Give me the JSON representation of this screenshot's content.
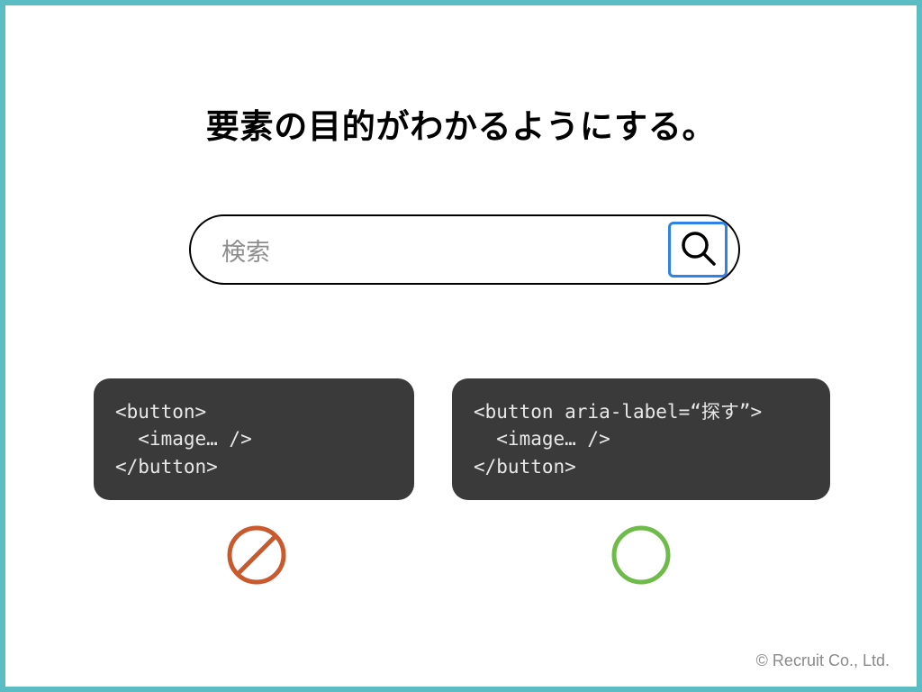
{
  "title": "要素の目的がわかるようにする。",
  "search": {
    "placeholder": "検索"
  },
  "code": {
    "bad": "<button>\n  <image… />\n</button>",
    "good": "<button aria-label=“探す”>\n  <image… />\n</button>"
  },
  "footer": {
    "copyright": "© Recruit Co., Ltd."
  }
}
